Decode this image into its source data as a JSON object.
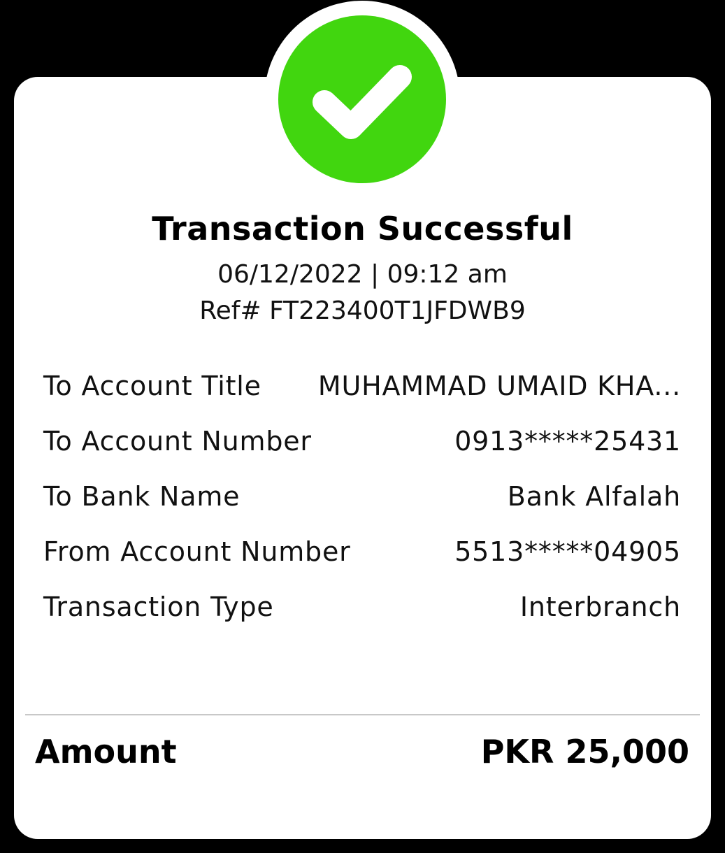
{
  "colors": {
    "background": "#000000",
    "card": "#ffffff",
    "success_green": "#41d60f",
    "check_mark": "#ffffff"
  },
  "status": {
    "icon": "check-circle-icon",
    "title": "Transaction Successful",
    "datetime": "06/12/2022 | 09:12 am",
    "reference": "Ref# FT223400T1JFDWB9"
  },
  "details": [
    {
      "label": "To Account Title",
      "value": "MUHAMMAD UMAID KHA..."
    },
    {
      "label": "To Account Number",
      "value": "0913*****25431"
    },
    {
      "label": "To Bank Name",
      "value": "Bank Alfalah"
    },
    {
      "label": "From Account Number",
      "value": "5513*****04905"
    },
    {
      "label": "Transaction Type",
      "value": "Interbranch"
    }
  ],
  "amount": {
    "label": "Amount",
    "value": "PKR 25,000"
  }
}
